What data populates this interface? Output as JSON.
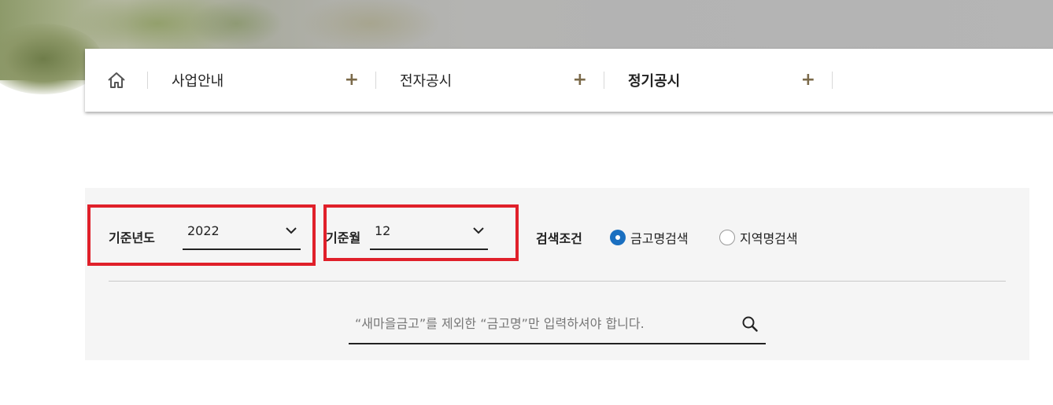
{
  "nav": {
    "home_icon": "home-icon",
    "items": [
      {
        "label": "사업안내",
        "toggle": "+"
      },
      {
        "label": "전자공시",
        "toggle": "+"
      },
      {
        "label": "정기공시",
        "toggle": "+"
      }
    ]
  },
  "filters": {
    "year_label": "기준년도",
    "year_value": "2022",
    "month_label": "기준월",
    "month_value": "12",
    "condition_label": "검색조건",
    "radio_options": [
      {
        "label": "금고명검색",
        "selected": true
      },
      {
        "label": "지역명검색",
        "selected": false
      }
    ]
  },
  "search": {
    "placeholder": "“새마을금고”를 제외한 “금고명”만 입력하셔야 합니다.",
    "value": "",
    "icon": "search-icon"
  },
  "colors": {
    "accent": "#7b6a4a",
    "highlight": "#e0202a",
    "radio_selected": "#1a6fc0",
    "panel_bg": "#f5f5f5"
  }
}
